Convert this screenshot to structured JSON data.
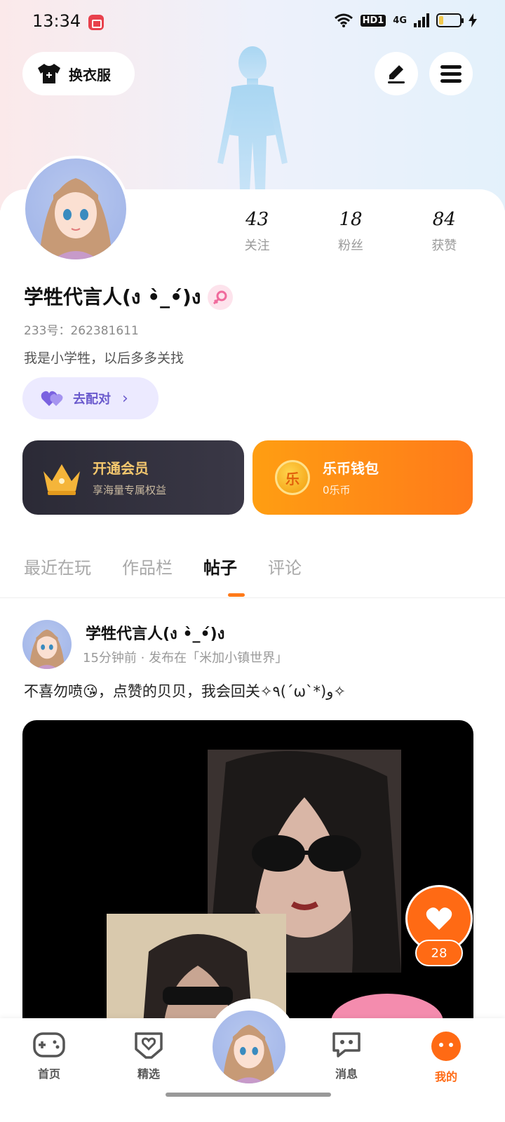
{
  "status_bar": {
    "time": "13:34",
    "network_badge": "HD1",
    "signal_label": "4G"
  },
  "top_bar": {
    "outfit_label": "换衣服"
  },
  "profile": {
    "stats": [
      {
        "value": "43",
        "label": "关注"
      },
      {
        "value": "18",
        "label": "粉丝"
      },
      {
        "value": "84",
        "label": "获赞"
      }
    ],
    "username": "学牲代言人(ง •̀_•́)ง",
    "uid": "233号：262381611",
    "bio": "我是小学牲，以后多多关找",
    "match_label": "去配对"
  },
  "cards": {
    "vip": {
      "title": "开通会员",
      "subtitle": "享海量专属权益"
    },
    "wallet": {
      "title": "乐币钱包",
      "subtitle": "0乐币",
      "coin_char": "乐"
    }
  },
  "tabs": [
    {
      "label": "最近在玩",
      "active": false
    },
    {
      "label": "作品栏",
      "active": false
    },
    {
      "label": "帖子",
      "active": true
    },
    {
      "label": "评论",
      "active": false
    }
  ],
  "post": {
    "author": "学牲代言人(ง •̀_•́)ง",
    "meta": "15分钟前 · 发布在「米加小镇世界」",
    "text": "不喜勿喷😘，点赞的贝贝，我会回关✧٩(ˊωˋ*)و✧",
    "like_count": "28"
  },
  "bottom_nav": [
    {
      "label": "首页",
      "icon": "gamepad-icon",
      "active": false
    },
    {
      "label": "精选",
      "icon": "heart-box-icon",
      "active": false
    },
    {
      "label": "消息",
      "icon": "chat-icon",
      "active": false
    },
    {
      "label": "我的",
      "icon": "face-icon",
      "active": true
    }
  ],
  "colors": {
    "accent": "#ff6a14",
    "match_purple": "#6a5acd",
    "vip_gold": "#f5c86e"
  }
}
